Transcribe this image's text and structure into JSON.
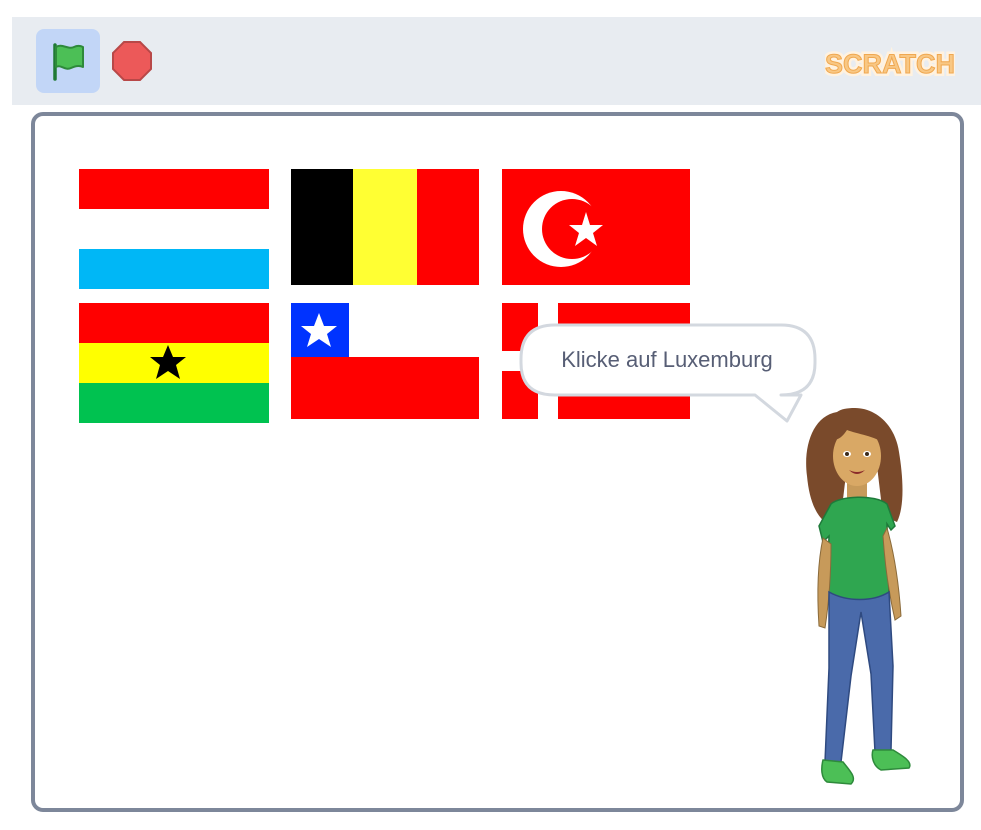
{
  "toolbar": {
    "green_flag_icon": "green-flag-icon",
    "stop_icon": "stop-sign-icon",
    "logo_text": "SCRATCH",
    "colors": {
      "toolbar_bg": "#e8ecf1",
      "flag_active_bg": "#c2d6f7",
      "stop": "#ec5959",
      "logo": "#f5b96b"
    }
  },
  "stage": {
    "flags": [
      {
        "country": "Luxembourg",
        "colors": [
          "#ff0000",
          "#ffffff",
          "#00b7f6"
        ]
      },
      {
        "country": "Belgium",
        "colors": [
          "#000000",
          "#ffff33",
          "#ff0000"
        ]
      },
      {
        "country": "Turkey",
        "colors": [
          "#ff0000",
          "#ffffff"
        ]
      },
      {
        "country": "Ghana",
        "colors": [
          "#ff0000",
          "#ffff00",
          "#00c250",
          "#000000"
        ]
      },
      {
        "country": "Chile",
        "colors": [
          "#0033ff",
          "#ffffff",
          "#ff0000"
        ]
      },
      {
        "country": "Denmark",
        "colors": [
          "#ff0000",
          "#ffffff"
        ]
      }
    ],
    "speech_bubble": {
      "text": "Klicke auf Luxemburg"
    },
    "sprite": {
      "name": "girl-sprite"
    }
  }
}
